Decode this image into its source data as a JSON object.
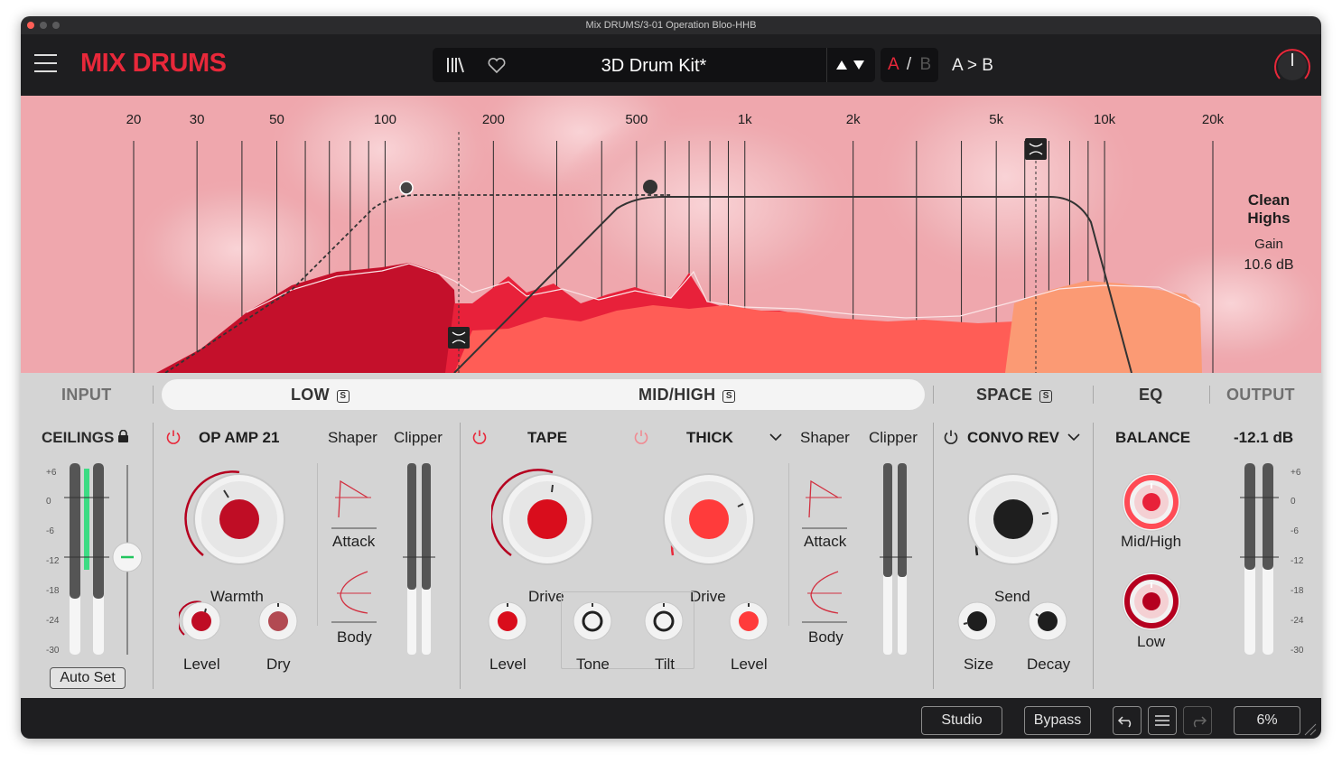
{
  "window": {
    "title": "Mix DRUMS/3-01 Operation Bloo-HHB"
  },
  "header": {
    "brand": "MIX DRUMS",
    "preset_name": "3D Drum Kit*",
    "ab_a": "A",
    "ab_sep": "/",
    "ab_b": "B",
    "a_to_b": "A > B"
  },
  "eq": {
    "freq_labels": [
      "20",
      "30",
      "50",
      "100",
      "200",
      "500",
      "1k",
      "2k",
      "5k",
      "10k",
      "20k"
    ],
    "info_title_line1": "Clean",
    "info_title_line2": "Highs",
    "info_param": "Gain",
    "info_value": "10.6 dB"
  },
  "tabs": {
    "input": "INPUT",
    "low": "LOW",
    "midhigh": "MID/HIGH",
    "space": "SPACE",
    "eq": "EQ",
    "output": "OUTPUT",
    "solo": "S"
  },
  "input": {
    "ceilings": "CEILINGS",
    "scale": [
      "+6",
      "0",
      "-6",
      "-12",
      "-18",
      "-24",
      "-30"
    ],
    "auto_set": "Auto Set"
  },
  "low": {
    "module": "OP AMP 21",
    "shaper": "Shaper",
    "clipper": "Clipper",
    "warmth": "Warmth",
    "level": "Level",
    "dry": "Dry",
    "attack": "Attack",
    "body": "Body"
  },
  "midhigh": {
    "tape": "TAPE",
    "thick": "THICK",
    "shaper": "Shaper",
    "clipper": "Clipper",
    "tape_drive": "Drive",
    "thick_drive": "Drive",
    "level_left": "Level",
    "tone": "Tone",
    "tilt": "Tilt",
    "level_right": "Level",
    "attack": "Attack",
    "body": "Body"
  },
  "space": {
    "module": "CONVO REV",
    "send": "Send",
    "size": "Size",
    "decay": "Decay"
  },
  "eq_section": {
    "balance": "BALANCE",
    "midhigh": "Mid/High",
    "low": "Low"
  },
  "output": {
    "value": "-12.1 dB",
    "scale": [
      "+6",
      "0",
      "-6",
      "-12",
      "-18",
      "-24",
      "-30"
    ]
  },
  "footer": {
    "studio": "Studio",
    "bypass": "Bypass",
    "zoom": "6%"
  },
  "colors": {
    "accent": "#e8283a",
    "header_bg": "#1e1e20",
    "panel_bg": "#d4d4d4",
    "eq_bg": "#efa7ad"
  }
}
